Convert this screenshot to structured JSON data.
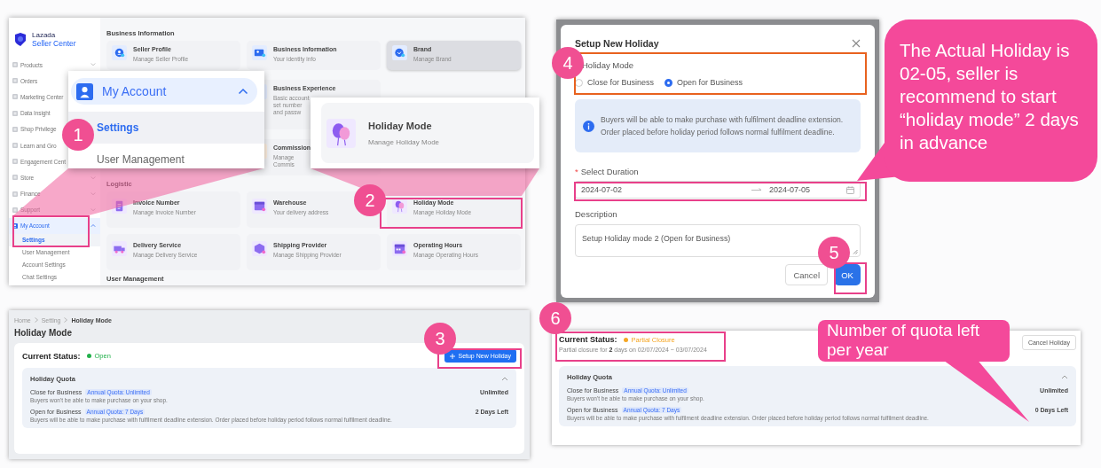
{
  "seller_center": {
    "logo": {
      "brand": "Lazada",
      "product": "Seller Center"
    },
    "sidebar": [
      {
        "label": "Products",
        "expanded": false
      },
      {
        "label": "Orders"
      },
      {
        "label": "Marketing Center"
      },
      {
        "label": "Data Insight"
      },
      {
        "label": "Shop Privilege"
      },
      {
        "label": "Learn and Gro"
      },
      {
        "label": "Engagement Cent"
      },
      {
        "label": "Store",
        "expanded": false
      },
      {
        "label": "Finance",
        "expanded": false
      },
      {
        "label": "Support",
        "expanded": false
      },
      {
        "label": "My Account",
        "expanded": true,
        "children": [
          {
            "label": "Settings",
            "selected": true
          },
          {
            "label": "User Management",
            "selected": false
          },
          {
            "label": "Account Settings",
            "selected": false
          },
          {
            "label": "Chat Settings",
            "selected": false
          }
        ]
      }
    ],
    "sections": [
      {
        "title": "Business Information",
        "tiles": [
          {
            "title": "Seller Profile",
            "subtitle": "Manage Seller Profile",
            "hovered": false
          },
          {
            "title": "Business Information",
            "subtitle": "Your identity info",
            "hovered": false
          },
          {
            "title": "Brand",
            "subtitle": "Manage Brand",
            "hovered": true
          },
          {
            "title": "Business Experience",
            "subtitle": "Basic account set number and passw",
            "hovered": false
          },
          {
            "title": "Commission",
            "subtitle": "Manage Commis",
            "hovered": false
          }
        ]
      },
      {
        "title": "Logistic",
        "tiles": [
          {
            "title": "Invoice Number",
            "subtitle": "Manage Invoice Number",
            "hovered": false
          },
          {
            "title": "Warehouse",
            "subtitle": "Your delivery address",
            "hovered": false
          },
          {
            "title": "Holiday Mode",
            "subtitle": "Manage Holiday Mode",
            "hovered": false
          },
          {
            "title": "Delivery Service",
            "subtitle": "Manage Delivery Service",
            "hovered": false
          },
          {
            "title": "Shipping Provider",
            "subtitle": "Manage Shipping Provider",
            "hovered": false
          },
          {
            "title": "Operating Hours",
            "subtitle": "Manage Operating Hours",
            "hovered": false
          }
        ]
      },
      {
        "title": "User Management"
      }
    ]
  },
  "account_zoom": {
    "step": "1",
    "header": "My Account",
    "expanded": true,
    "items": [
      {
        "label": "Settings",
        "selected": true
      },
      {
        "label": "User Management",
        "selected": false
      }
    ]
  },
  "holiday_zoom": {
    "step": "2",
    "title": "Holiday Mode",
    "subtitle": "Manage Holiday Mode"
  },
  "dialog": {
    "step": "4",
    "ok_step": "5",
    "title": "Setup New Holiday",
    "mode_label": "Holiday Mode",
    "modes": [
      {
        "label": "Close for Business",
        "selected": false
      },
      {
        "label": "Open for Business",
        "selected": true
      }
    ],
    "info": "Buyers will be able to make purchase with fulfilment deadline extension. Order placed before holiday period follows normal fulfilment deadline.",
    "required_mark": "*",
    "duration_label": "Select Duration",
    "start": "2024-07-02",
    "end": "2024-07-05",
    "description_label": "Description",
    "description": "Setup Holiday mode 2 (Open for Business)",
    "buttons": [
      {
        "label": "Cancel",
        "kind": "secondary"
      },
      {
        "label": "OK",
        "kind": "primary"
      }
    ]
  },
  "advice_bubble": "The Actual Holiday is 02-05, seller is recommend to start “holiday mode” 2 days in advance",
  "holiday_page": {
    "step": "3",
    "breadcrumb": [
      "Home",
      "Setting",
      "Holiday Mode"
    ],
    "title": "Holiday Mode",
    "status_label": "Current Status:",
    "status": {
      "text": "Open",
      "kind": "open"
    },
    "action": "Setup New Holiday",
    "quota": {
      "title": "Holiday Quota",
      "expanded": true,
      "rows": [
        {
          "name": "Close for Business",
          "badge": "Annual Quota: Unlimited",
          "description": "Buyers won't be able to make purchase on your shop.",
          "value": "Unlimited"
        },
        {
          "name": "Open for Business",
          "badge": "Annual Quota: 7 Days",
          "description": "Buyers will be able to make purchase with fulfilment deadline extension. Order placed before holiday period follows normal fulfilment deadline.",
          "value": "2 Days Left"
        }
      ]
    }
  },
  "result_page": {
    "step": "6",
    "status_label": "Current Status:",
    "status": {
      "text": "Partial Closure",
      "kind": "partial"
    },
    "detail": "Partial closure for **2** days on 02/07/2024 ~ 03/07/2024",
    "action": "Cancel Holiday",
    "quota": {
      "title": "Holiday Quota",
      "expanded": true,
      "rows": [
        {
          "name": "Close for Business",
          "badge": "Annual Quota: Unlimited",
          "description": "Buyers won't be able to make purchase on your shop.",
          "value": "Unlimited"
        },
        {
          "name": "Open for Business",
          "badge": "Annual Quota: 7 Days",
          "description": "Buyers will be able to make purchase with fulfilment deadline extension. Order placed before holiday period follows normal fulfilment deadline.",
          "value": "0 Days Left"
        }
      ]
    }
  },
  "quota_bubble": "Number of quota left per year"
}
